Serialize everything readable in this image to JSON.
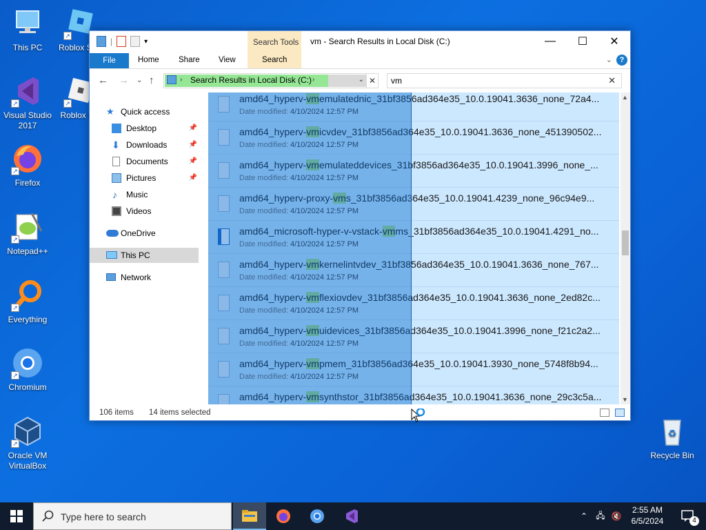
{
  "desktop": {
    "icons": [
      {
        "label": "This PC"
      },
      {
        "label": "Roblox St..."
      },
      {
        "label": "Visual Studio 2017"
      },
      {
        "label": "Roblox P..."
      },
      {
        "label": "Firefox"
      },
      {
        "label": "Notepad++"
      },
      {
        "label": "Everything"
      },
      {
        "label": "Chromium"
      },
      {
        "label": "Oracle VM VirtualBox"
      },
      {
        "label": "Recycle Bin"
      }
    ]
  },
  "window": {
    "title": "vm - Search Results in Local Disk (C:)",
    "search_tools_label": "Search Tools",
    "controls": {
      "minimize": "—",
      "maximize": "☐",
      "close": "✕"
    },
    "tabs": {
      "file": "File",
      "home": "Home",
      "share": "Share",
      "view": "View",
      "search": "Search"
    },
    "address": {
      "crumb": "Search Results in Local Disk (C:)"
    },
    "search": {
      "value": "vm"
    },
    "nav": {
      "quick_access": "Quick access",
      "desktop": "Desktop",
      "downloads": "Downloads",
      "documents": "Documents",
      "pictures": "Pictures",
      "music": "Music",
      "videos": "Videos",
      "onedrive": "OneDrive",
      "this_pc": "This PC",
      "network": "Network"
    },
    "results": [
      {
        "pre": "amd64_hyperv-",
        "hl": "vm",
        "post": "emulatednic_31bf3856ad364e35_10.0.19041.3636_none_72a4...",
        "date_label": "Date modified:",
        "date": "4/10/2024 12:57 PM"
      },
      {
        "pre": "amd64_hyperv-",
        "hl": "vm",
        "post": "icvdev_31bf3856ad364e35_10.0.19041.3636_none_451390502...",
        "date_label": "Date modified:",
        "date": "4/10/2024 12:57 PM"
      },
      {
        "pre": "amd64_hyperv-",
        "hl": "vm",
        "post": "emulateddevices_31bf3856ad364e35_10.0.19041.3996_none_...",
        "date_label": "Date modified:",
        "date": "4/10/2024 12:57 PM"
      },
      {
        "pre": "amd64_hyperv-proxy-",
        "hl": "vm",
        "post": "s_31bf3856ad364e35_10.0.19041.4239_none_96c94e9...",
        "date_label": "Date modified:",
        "date": "4/10/2024 12:57 PM"
      },
      {
        "pre": "amd64_microsoft-hyper-v-vstack-",
        "hl": "vm",
        "post": "ms_31bf3856ad364e35_10.0.19041.4291_no...",
        "date_label": "Date modified:",
        "date": "4/10/2024 12:57 PM"
      },
      {
        "pre": "amd64_hyperv-",
        "hl": "vm",
        "post": "kernelintvdev_31bf3856ad364e35_10.0.19041.3636_none_767...",
        "date_label": "Date modified:",
        "date": "4/10/2024 12:57 PM"
      },
      {
        "pre": "amd64_hyperv-",
        "hl": "vm",
        "post": "flexiovdev_31bf3856ad364e35_10.0.19041.3636_none_2ed82c...",
        "date_label": "Date modified:",
        "date": "4/10/2024 12:57 PM"
      },
      {
        "pre": "amd64_hyperv-",
        "hl": "vm",
        "post": "uidevices_31bf3856ad364e35_10.0.19041.3996_none_f21c2a2...",
        "date_label": "Date modified:",
        "date": "4/10/2024 12:57 PM"
      },
      {
        "pre": "amd64_hyperv-",
        "hl": "vm",
        "post": "pmem_31bf3856ad364e35_10.0.19041.3930_none_5748f8b94...",
        "date_label": "Date modified:",
        "date": "4/10/2024 12:57 PM"
      },
      {
        "pre": "amd64_hyperv-",
        "hl": "vm",
        "post": "synthstor_31bf3856ad364e35_10.0.19041.3636_none_29c3c5a...",
        "date_label": "",
        "date": ""
      }
    ],
    "status": {
      "items": "106 items",
      "selected": "14 items selected"
    }
  },
  "taskbar": {
    "search_placeholder": "Type here to search",
    "time": "2:55 AM",
    "date": "6/5/2024",
    "notification_count": "4"
  }
}
